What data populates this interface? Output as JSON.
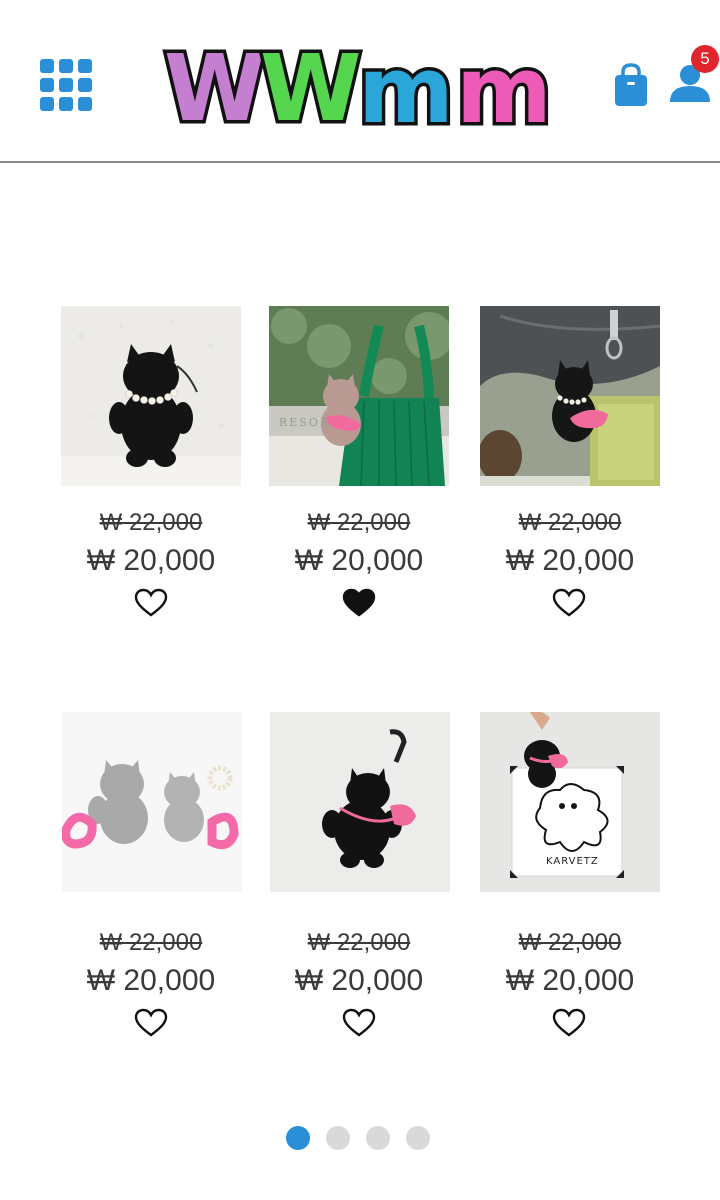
{
  "header": {
    "logo_letters": [
      "W",
      "W",
      "m",
      "m"
    ],
    "logo_colors": [
      "#c47fd1",
      "#56d64e",
      "#2aa6d8",
      "#ee5ab8"
    ],
    "cart_count": "5",
    "icons": {
      "menu": "grid-menu-icon",
      "cart": "shopping-bag-icon",
      "account": "user-icon"
    }
  },
  "accent_color": "#2a8fd6",
  "products": [
    {
      "original_price": "₩ 22,000",
      "sale_price": "₩ 20,000",
      "wishlisted": false,
      "photo": "black plush keychain with pearl necklace"
    },
    {
      "original_price": "₩ 22,000",
      "sale_price": "₩ 20,000",
      "wishlisted": true,
      "photo": "grey plush keychain on green bag"
    },
    {
      "original_price": "₩ 22,000",
      "sale_price": "₩ 20,000",
      "wishlisted": false,
      "photo": "black plush keychain with pink bag on backpack"
    },
    {
      "original_price": "₩ 22,000",
      "sale_price": "₩ 20,000",
      "wishlisted": false,
      "photo": "two grey plush keychains with pink straps"
    },
    {
      "original_price": "₩ 22,000",
      "sale_price": "₩ 20,000",
      "wishlisted": false,
      "photo": "black plush keychain with carabiner"
    },
    {
      "original_price": "₩ 22,000",
      "sale_price": "₩ 20,000",
      "wishlisted": false,
      "photo": "black plush keychain held over drawing",
      "photo_text": "KARVETZ"
    }
  ],
  "pagination": {
    "pages": 4,
    "current": 1
  }
}
